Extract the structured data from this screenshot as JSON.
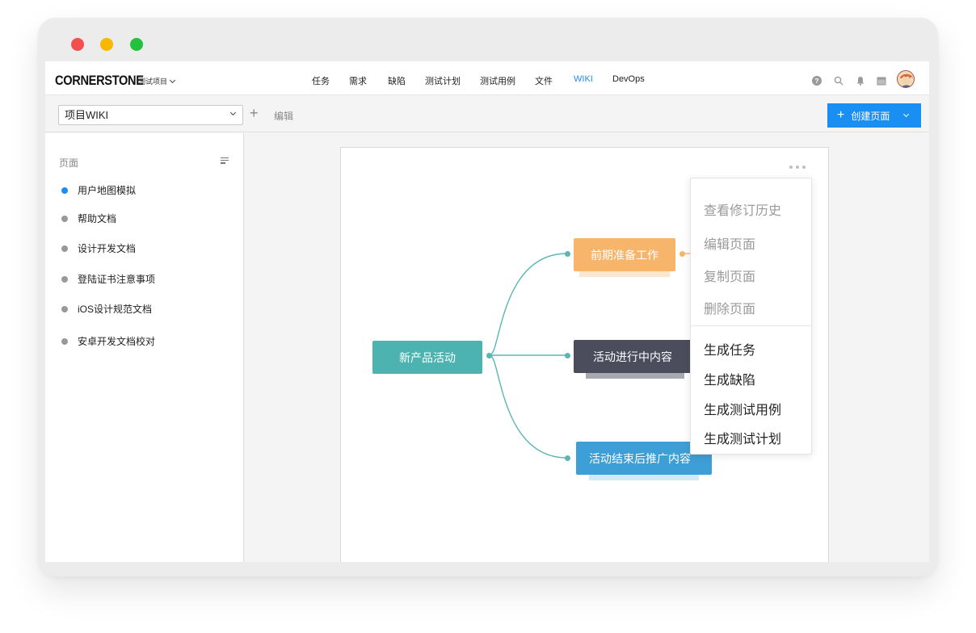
{
  "topnav": {
    "logo": "CORNERSTONE",
    "project_selector": "测试项目",
    "items": [
      {
        "label": "任务",
        "active": false
      },
      {
        "label": "需求",
        "active": false
      },
      {
        "label": "缺陷",
        "active": false
      },
      {
        "label": "测试计划",
        "active": false
      },
      {
        "label": "测试用例",
        "active": false
      },
      {
        "label": "文件",
        "active": false
      },
      {
        "label": "WIKI",
        "active": true
      },
      {
        "label": "DevOps",
        "active": false
      }
    ],
    "icons": [
      "help-icon",
      "search-icon",
      "bell-icon",
      "calendar-icon"
    ]
  },
  "toolbar": {
    "wiki_select_value": "项目WIKI",
    "add_symbol": "+",
    "edit_label": "编辑",
    "create_button_plus": "+",
    "create_button_label": "创建页面"
  },
  "sidebar": {
    "title": "页面",
    "items": [
      {
        "label": "用户地图模拟",
        "active": true
      },
      {
        "label": "帮助文档",
        "active": false
      },
      {
        "label": "设计开发文档",
        "active": false
      },
      {
        "label": "登陆证书注意事项",
        "active": false
      },
      {
        "label": "iOS设计规范文档",
        "active": false
      },
      {
        "label": "安卓开发文档校对",
        "active": false
      }
    ]
  },
  "mindmap": {
    "root": "新产品活动",
    "children": [
      "前期准备工作",
      "活动进行中内容",
      "活动结束后推广内容"
    ],
    "colors": {
      "root": "#4db3b0",
      "prep": "#f7b56b",
      "mid": "#4b4d5d",
      "end": "#3e9fd6",
      "line": "#5db5b3"
    }
  },
  "menu": {
    "items_disabled": [
      "查看修订历史",
      "编辑页面",
      "复制页面",
      "删除页面"
    ],
    "items_enabled": [
      "生成任务",
      "生成缺陷",
      "生成测试用例",
      "生成测试计划"
    ]
  },
  "accent_color": "#1a8ff3"
}
